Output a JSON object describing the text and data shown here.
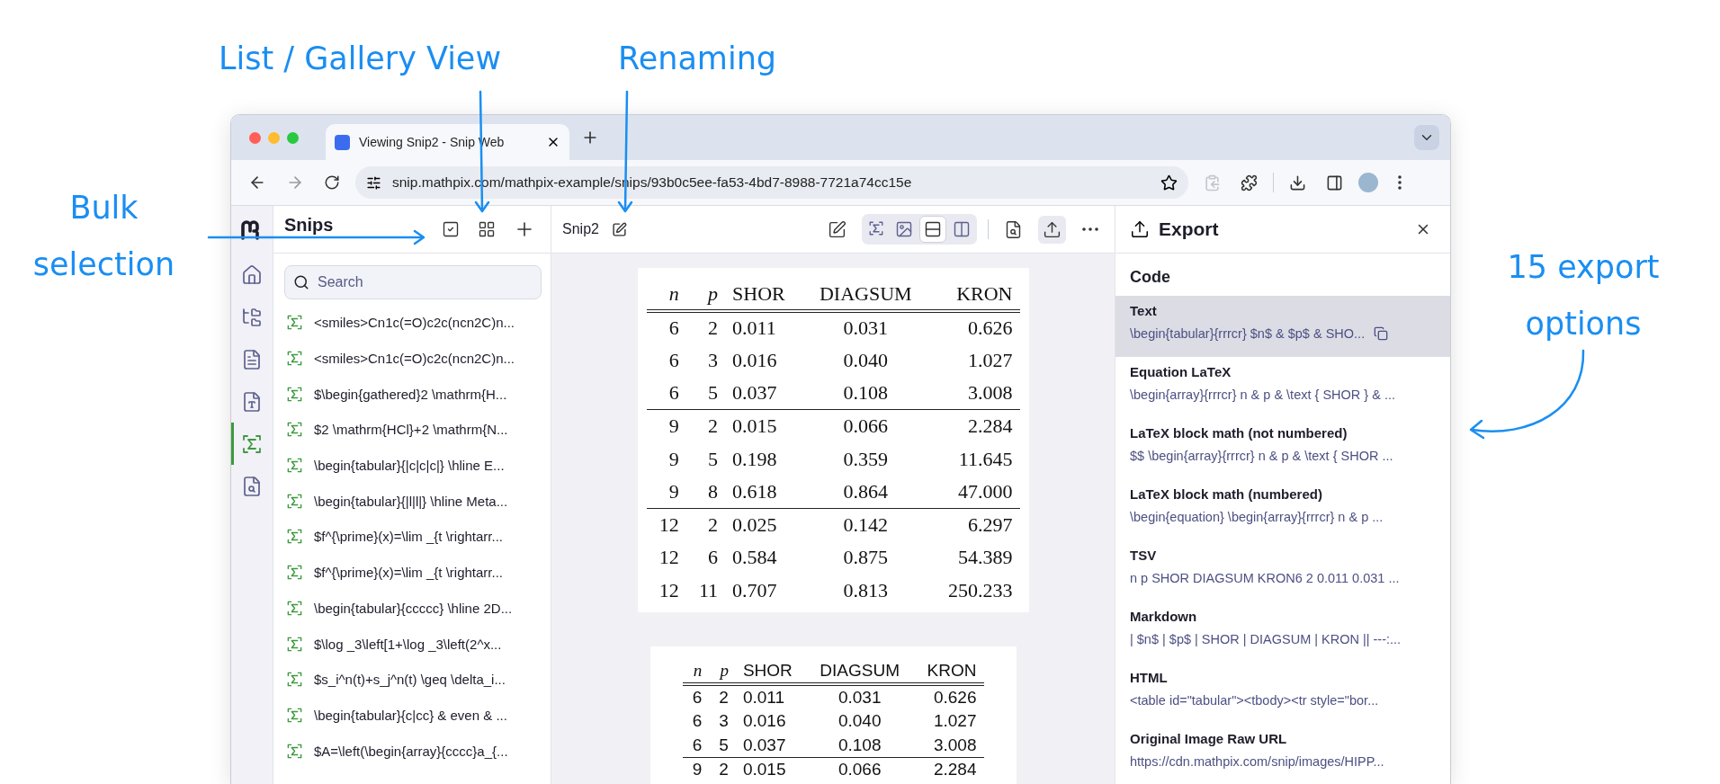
{
  "annotations": [
    {
      "text": "List / Gallery View"
    },
    {
      "text": "Renaming"
    },
    {
      "text": "Bulk selection"
    },
    {
      "text": "15 export options"
    }
  ],
  "browser": {
    "tab_title": "Viewing Snip2 - Snip Web",
    "url": "snip.mathpix.com/mathpix-example/snips/93b0c5ee-fa53-4bd7-8988-7721a74cc15e"
  },
  "rail": [
    {
      "kind": "home",
      "selected": false
    },
    {
      "kind": "tree",
      "selected": false
    },
    {
      "kind": "document",
      "selected": false
    },
    {
      "kind": "pdf",
      "selected": false
    },
    {
      "kind": "sigma",
      "selected": true
    },
    {
      "kind": "file-search",
      "selected": false
    }
  ],
  "snips": {
    "title": "Snips",
    "search": {
      "placeholder": "Search"
    },
    "items": [
      "<smiles>Cn1c(=O)c2c(ncn2C)n...",
      "<smiles>Cn1c(=O)c2c(ncn2C)n...",
      "$\\begin{gathered}2 \\mathrm{H...",
      "$2 \\mathrm{HCl}+2 \\mathrm{N...",
      "\\begin{tabular}{|c|c|c|} \\hline E...",
      "\\begin{tabular}{|l|l|} \\hline Meta...",
      "$f^{\\prime}(x)=\\lim _{t \\rightarr...",
      "$f^{\\prime}(x)=\\lim _{t \\rightarr...",
      "\\begin{tabular}{ccccc} \\hline 2D...",
      "$\\log _3\\left[1+\\log _3\\left(2^x...",
      "$s_i^n(t)+s_j^n(t) \\geq \\delta_i...",
      "\\begin{tabular}{c|cc} & even & ...",
      "$A=\\left(\\begin{array}{cccc}a_{..."
    ]
  },
  "snip": {
    "title": "Snip2",
    "view_modes": [
      {
        "kind": "sigma",
        "selected": false
      },
      {
        "kind": "image",
        "selected": false
      },
      {
        "kind": "rows",
        "selected": true
      },
      {
        "kind": "columns",
        "selected": false
      }
    ],
    "tables": [
      {
        "kind": "image",
        "columns": [
          {
            "label": "n",
            "math": true
          },
          {
            "label": "p",
            "math": true
          },
          {
            "label": "SHOR",
            "math": false
          },
          {
            "label": "DIAGSUM",
            "math": false
          },
          {
            "label": "KRON",
            "math": false
          }
        ],
        "groups": [
          [
            [
              "6",
              "2",
              "0.011",
              "0.031",
              "0.626"
            ],
            [
              "6",
              "3",
              "0.016",
              "0.040",
              "1.027"
            ],
            [
              "6",
              "5",
              "0.037",
              "0.108",
              "3.008"
            ]
          ],
          [
            [
              "9",
              "2",
              "0.015",
              "0.066",
              "2.284"
            ],
            [
              "9",
              "5",
              "0.198",
              "0.359",
              "11.645"
            ],
            [
              "9",
              "8",
              "0.618",
              "0.864",
              "47.000"
            ]
          ],
          [
            [
              "12",
              "2",
              "0.025",
              "0.142",
              "6.297"
            ],
            [
              "12",
              "6",
              "0.584",
              "0.875",
              "54.389"
            ],
            [
              "12",
              "11",
              "0.707",
              "0.813",
              "250.233"
            ]
          ]
        ]
      },
      {
        "kind": "rendered",
        "columns": [
          {
            "label": "n",
            "math": true
          },
          {
            "label": "p",
            "math": true
          },
          {
            "label": "SHOR",
            "math": false
          },
          {
            "label": "DIAGSUM",
            "math": false
          },
          {
            "label": "KRON",
            "math": false
          }
        ],
        "groups": [
          [
            [
              "6",
              "2",
              "0.011",
              "0.031",
              "0.626"
            ],
            [
              "6",
              "3",
              "0.016",
              "0.040",
              "1.027"
            ],
            [
              "6",
              "5",
              "0.037",
              "0.108",
              "3.008"
            ]
          ],
          [
            [
              "9",
              "2",
              "0.015",
              "0.066",
              "2.284"
            ]
          ]
        ]
      }
    ]
  },
  "export": {
    "title": "Export",
    "section": "Code",
    "items": [
      {
        "label": "Text",
        "value": "\\begin{tabular}{rrrcr} $n$ & $p$ & SHO...",
        "selected": true
      },
      {
        "label": "Equation LaTeX",
        "value": "\\begin{array}{rrrcr} n & p & \\text { SHOR } & ...",
        "selected": false
      },
      {
        "label": "LaTeX block math (not numbered)",
        "value": "$$ \\begin{array}{rrrcr} n & p & \\text { SHOR ...",
        "selected": false
      },
      {
        "label": "LaTeX block math (numbered)",
        "value": "\\begin{equation} \\begin{array}{rrrcr} n & p ...",
        "selected": false
      },
      {
        "label": "TSV",
        "value": "n p SHOR DIAGSUM KRON6 2 0.011 0.031 ...",
        "selected": false
      },
      {
        "label": "Markdown",
        "value": "| $n$ | $p$ | SHOR | DIAGSUM | KRON || ---:...",
        "selected": false
      },
      {
        "label": "HTML",
        "value": "<table id=\"tabular\"><tbody><tr style=\"bor...",
        "selected": false
      },
      {
        "label": "Original Image Raw URL",
        "value": "https://cdn.mathpix.com/snip/images/HIPP...",
        "selected": false
      }
    ]
  }
}
